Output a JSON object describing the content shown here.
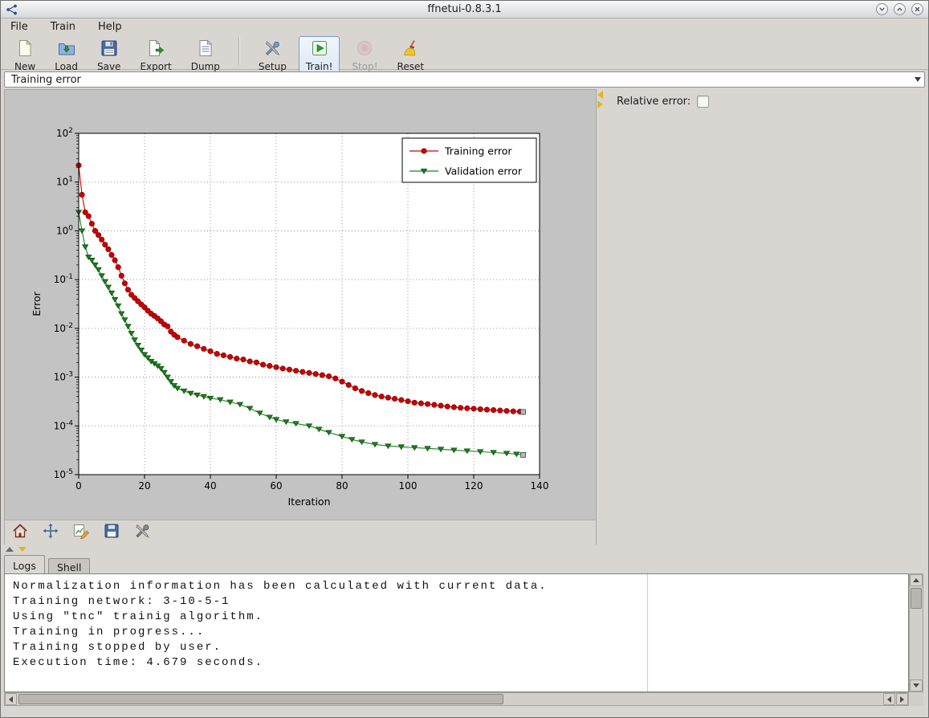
{
  "window": {
    "title": "ffnetui-0.8.3.1"
  },
  "menubar": {
    "items": [
      "File",
      "Train",
      "Help"
    ]
  },
  "toolbar": {
    "items": [
      {
        "label": "New"
      },
      {
        "label": "Load"
      },
      {
        "label": "Save"
      },
      {
        "label": "Export"
      },
      {
        "label": "Dump"
      },
      {
        "label": "Setup"
      },
      {
        "label": "Train!",
        "highlighted": true
      },
      {
        "label": "Stop!",
        "enabled": false
      },
      {
        "label": "Reset"
      }
    ]
  },
  "plot_selector": {
    "value": "Training error"
  },
  "side_panel": {
    "relative_error_label": "Relative error:",
    "relative_error_checked": false
  },
  "tabs": {
    "items": [
      "Logs",
      "Shell"
    ],
    "active": "Logs"
  },
  "logs": {
    "lines": [
      "Normalization information has been calculated with current data.",
      "Training network: 3-10-5-1",
      "Using \"tnc\" trainig algorithm.",
      "Training in progress...",
      "Training stopped by user.",
      "Execution time: 4.679 seconds."
    ]
  },
  "chart_data": {
    "type": "line",
    "xlabel": "Iteration",
    "ylabel": "Error",
    "xlim": [
      0,
      140
    ],
    "ylim_log10": [
      -5,
      2
    ],
    "xticks": [
      0,
      20,
      40,
      60,
      80,
      100,
      120,
      140
    ],
    "ytick_base": 10,
    "ytick_exponents": [
      2,
      1,
      0,
      -1,
      -2,
      -3,
      -4,
      -5
    ],
    "grid": true,
    "yscale": "log",
    "legend_position": "upper right",
    "final_marker_color": "#b8b8b8",
    "series": [
      {
        "name": "Training error",
        "color": "#cc0000",
        "edge": "#7a0000",
        "marker": "circle",
        "points": [
          [
            0,
            22
          ],
          [
            1,
            5.5
          ],
          [
            2,
            2.4
          ],
          [
            3,
            2.0
          ],
          [
            4,
            1.4
          ],
          [
            5,
            1.0
          ],
          [
            6,
            0.82
          ],
          [
            7,
            0.66
          ],
          [
            8,
            0.52
          ],
          [
            9,
            0.42
          ],
          [
            10,
            0.32
          ],
          [
            11,
            0.25
          ],
          [
            12,
            0.18
          ],
          [
            13,
            0.12
          ],
          [
            14,
            0.084
          ],
          [
            15,
            0.062
          ],
          [
            16,
            0.049
          ],
          [
            17,
            0.042
          ],
          [
            18,
            0.036
          ],
          [
            19,
            0.031
          ],
          [
            20,
            0.027
          ],
          [
            21,
            0.023
          ],
          [
            22,
            0.02
          ],
          [
            23,
            0.018
          ],
          [
            24,
            0.016
          ],
          [
            25,
            0.014
          ],
          [
            26,
            0.012
          ],
          [
            27,
            0.011
          ],
          [
            28,
            0.0086
          ],
          [
            29,
            0.0074
          ],
          [
            30,
            0.0066
          ],
          [
            32,
            0.0056
          ],
          [
            34,
            0.0048
          ],
          [
            36,
            0.0043
          ],
          [
            38,
            0.0038
          ],
          [
            40,
            0.0034
          ],
          [
            42,
            0.003
          ],
          [
            44,
            0.0028
          ],
          [
            46,
            0.0026
          ],
          [
            48,
            0.0024
          ],
          [
            50,
            0.0023
          ],
          [
            52,
            0.0021
          ],
          [
            54,
            0.002
          ],
          [
            56,
            0.0018
          ],
          [
            58,
            0.0017
          ],
          [
            60,
            0.0016
          ],
          [
            62,
            0.0015
          ],
          [
            64,
            0.00143
          ],
          [
            66,
            0.00135
          ],
          [
            68,
            0.00128
          ],
          [
            70,
            0.00122
          ],
          [
            72,
            0.00116
          ],
          [
            74,
            0.0011
          ],
          [
            76,
            0.00104
          ],
          [
            78,
            0.00094
          ],
          [
            80,
            0.00081
          ],
          [
            82,
            0.00069
          ],
          [
            84,
            0.00059
          ],
          [
            86,
            0.00052
          ],
          [
            88,
            0.00047
          ],
          [
            90,
            0.00043
          ],
          [
            92,
            0.0004
          ],
          [
            94,
            0.00038
          ],
          [
            96,
            0.00036
          ],
          [
            98,
            0.00034
          ],
          [
            100,
            0.00032
          ],
          [
            102,
            0.0003
          ],
          [
            104,
            0.00029
          ],
          [
            106,
            0.00028
          ],
          [
            108,
            0.00027
          ],
          [
            110,
            0.00026
          ],
          [
            112,
            0.00025
          ],
          [
            114,
            0.000242
          ],
          [
            116,
            0.000235
          ],
          [
            118,
            0.00023
          ],
          [
            120,
            0.000225
          ],
          [
            122,
            0.00022
          ],
          [
            124,
            0.000215
          ],
          [
            126,
            0.000211
          ],
          [
            128,
            0.000207
          ],
          [
            130,
            0.000203
          ],
          [
            132,
            0.000199
          ],
          [
            134,
            0.000196
          ],
          [
            135,
            0.000193
          ]
        ],
        "final_marker": true
      },
      {
        "name": "Validation error",
        "color": "#1e7d1e",
        "edge": "#0b4f0b",
        "marker": "triangle-down",
        "points": [
          [
            0,
            2.4
          ],
          [
            1,
            1.0
          ],
          [
            2,
            0.47
          ],
          [
            3,
            0.29
          ],
          [
            4,
            0.25
          ],
          [
            5,
            0.2
          ],
          [
            6,
            0.16
          ],
          [
            7,
            0.12
          ],
          [
            8,
            0.091
          ],
          [
            9,
            0.07
          ],
          [
            10,
            0.053
          ],
          [
            11,
            0.039
          ],
          [
            12,
            0.029
          ],
          [
            13,
            0.02
          ],
          [
            14,
            0.015
          ],
          [
            15,
            0.011
          ],
          [
            16,
            0.0079
          ],
          [
            17,
            0.0058
          ],
          [
            18,
            0.0045
          ],
          [
            19,
            0.0036
          ],
          [
            20,
            0.0029
          ],
          [
            21,
            0.0025
          ],
          [
            22,
            0.0021
          ],
          [
            23,
            0.0019
          ],
          [
            24,
            0.0017
          ],
          [
            25,
            0.0015
          ],
          [
            26,
            0.00125
          ],
          [
            27,
            0.001
          ],
          [
            28,
            0.00081
          ],
          [
            29,
            0.00067
          ],
          [
            30,
            0.00059
          ],
          [
            32,
            0.00052
          ],
          [
            34,
            0.000465
          ],
          [
            36,
            0.00043
          ],
          [
            38,
            0.0004
          ],
          [
            40,
            0.00037
          ],
          [
            43,
            0.000345
          ],
          [
            46,
            0.000308
          ],
          [
            49,
            0.000276
          ],
          [
            52,
            0.000229
          ],
          [
            55,
            0.000183
          ],
          [
            58,
            0.000151
          ],
          [
            60,
            0.000135
          ],
          [
            63,
            0.000121
          ],
          [
            66,
            0.000112
          ],
          [
            70,
            0.0001
          ],
          [
            73,
            8.55e-05
          ],
          [
            76,
            7.34e-05
          ],
          [
            80,
            6.09e-05
          ],
          [
            83,
            5.27e-05
          ],
          [
            86,
            4.68e-05
          ],
          [
            90,
            4.17e-05
          ],
          [
            94,
            3.87e-05
          ],
          [
            98,
            3.72e-05
          ],
          [
            102,
            3.58e-05
          ],
          [
            106,
            3.45e-05
          ],
          [
            110,
            3.32e-05
          ],
          [
            114,
            3.19e-05
          ],
          [
            118,
            3.07e-05
          ],
          [
            122,
            2.96e-05
          ],
          [
            126,
            2.85e-05
          ],
          [
            130,
            2.74e-05
          ],
          [
            133,
            2.64e-05
          ],
          [
            135,
            2.54e-05
          ]
        ],
        "final_marker": true
      }
    ]
  }
}
